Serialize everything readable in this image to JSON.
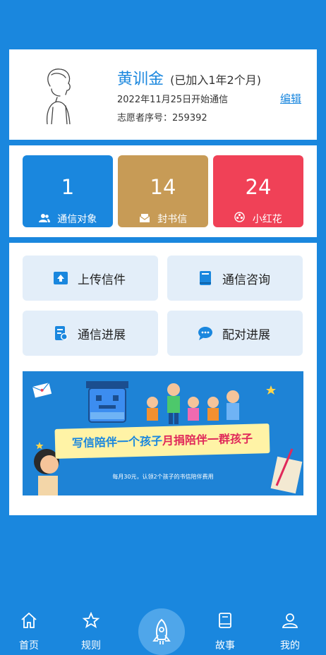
{
  "profile": {
    "name": "黄训金",
    "joined": "(已加入1年2个月)",
    "start_date": "2022年11月25日开始通信",
    "volunteer_no": "志愿者序号：259392",
    "edit_label": "编辑"
  },
  "stats": [
    {
      "value": "1",
      "label": "通信对象",
      "color": "#1a87de",
      "icon": "users-icon"
    },
    {
      "value": "14",
      "label": "封书信",
      "color": "#c79b56",
      "icon": "envelope-icon"
    },
    {
      "value": "24",
      "label": "小红花",
      "color": "#f04157",
      "icon": "flower-icon"
    }
  ],
  "actions": [
    {
      "label": "上传信件",
      "icon": "upload-icon"
    },
    {
      "label": "通信咨询",
      "icon": "book-icon"
    },
    {
      "label": "通信进展",
      "icon": "progress-icon"
    },
    {
      "label": "配对进展",
      "icon": "chat-icon"
    }
  ],
  "banner": {
    "headline_part1": "写信陪伴一个孩子",
    "headline_part2": "月捐陪伴一群孩子",
    "subtext": "每月30元，认领2个孩子的书信陪伴费用"
  },
  "tabbar": [
    {
      "label": "首页",
      "icon": "home-icon"
    },
    {
      "label": "规则",
      "icon": "star-icon"
    },
    {
      "label": "故事",
      "icon": "book-story-icon"
    },
    {
      "label": "我的",
      "icon": "profile-icon"
    }
  ]
}
